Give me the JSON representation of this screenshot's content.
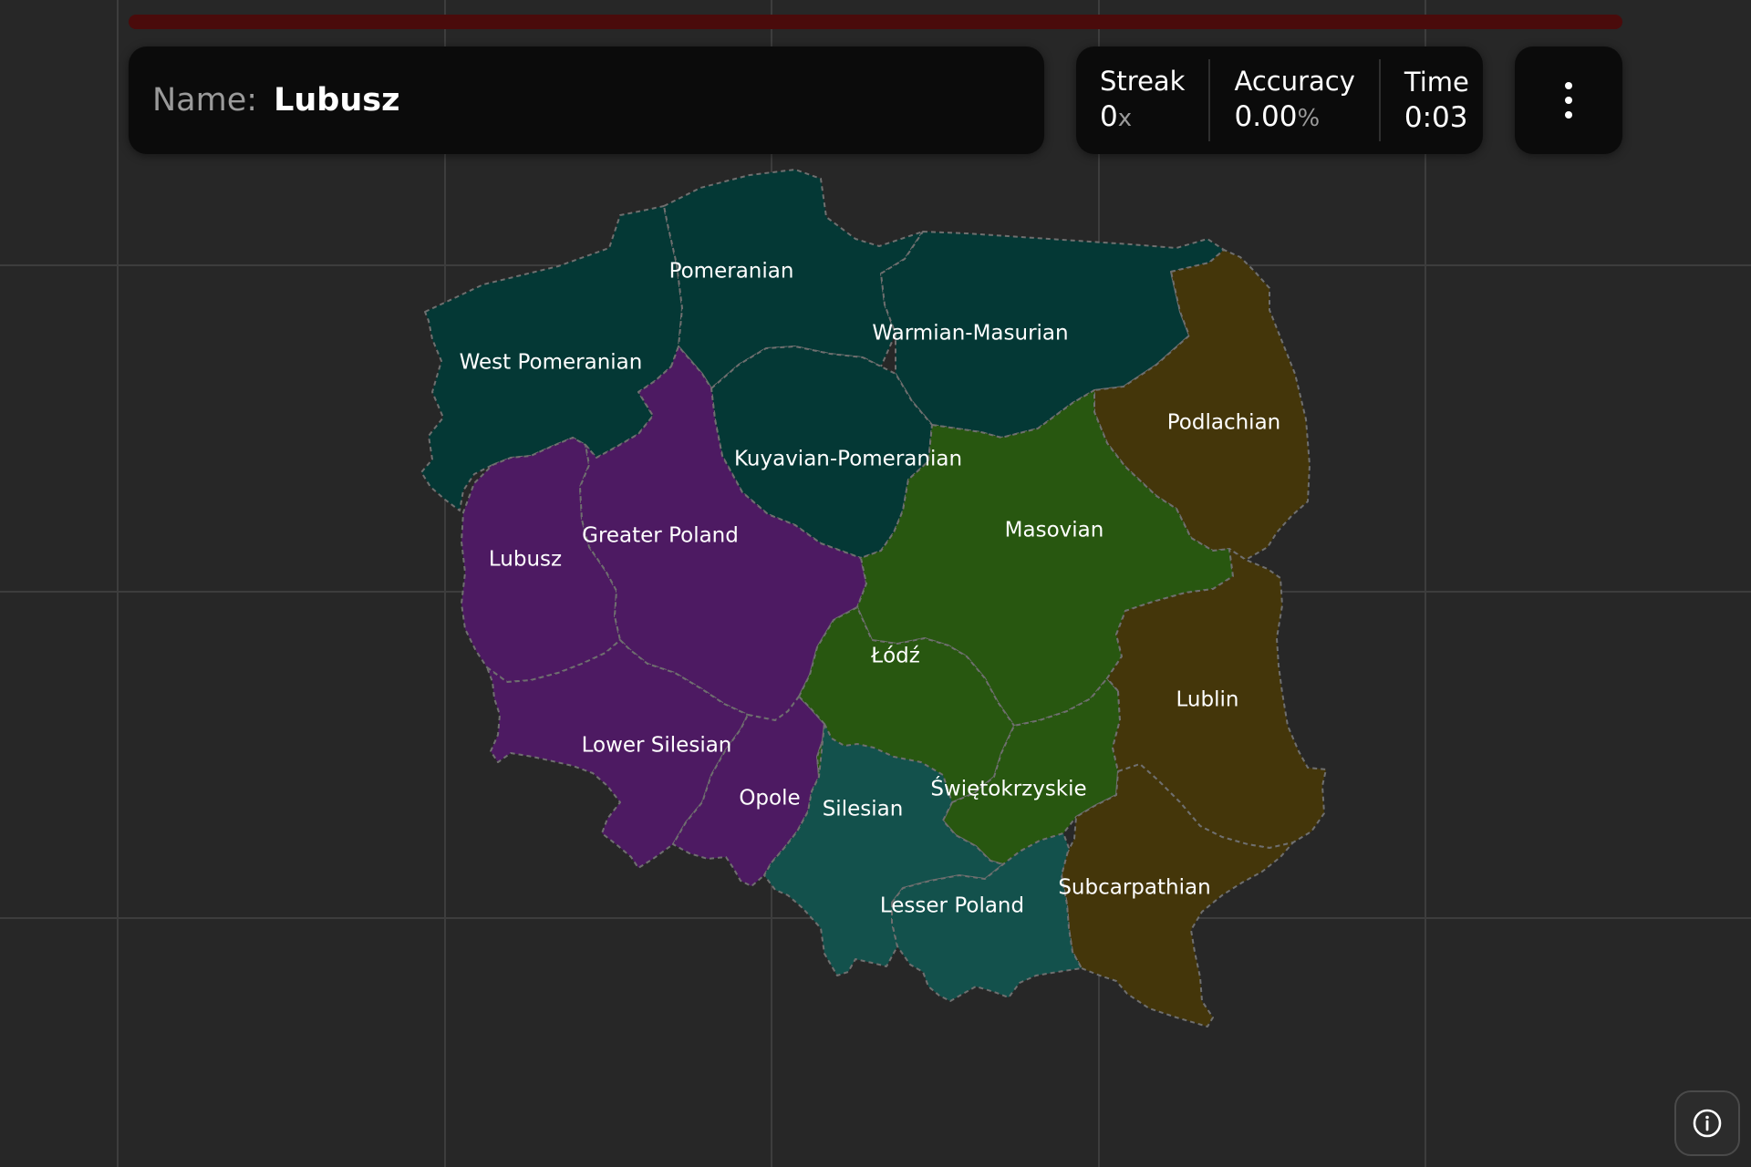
{
  "progress": {
    "fraction": 0,
    "track_color": "#4a0b0b",
    "fill_color": "#c0392b"
  },
  "prompt": {
    "prefix": "Name:",
    "value": "Lubusz"
  },
  "stats": {
    "streak": {
      "label": "Streak",
      "value": "0",
      "unit": "x"
    },
    "accuracy": {
      "label": "Accuracy",
      "value": "0.00",
      "unit": "%"
    },
    "time": {
      "label": "Time",
      "value": "0:03"
    }
  },
  "menu": {
    "icon": "more-vertical-icon"
  },
  "info": {
    "icon": "info-icon"
  },
  "map": {
    "country": "Poland",
    "regions": [
      {
        "id": "west-pomeranian",
        "name": "West Pomeranian",
        "color": "#043835"
      },
      {
        "id": "pomeranian",
        "name": "Pomeranian",
        "color": "#043835"
      },
      {
        "id": "warmian-masurian",
        "name": "Warmian-Masurian",
        "color": "#043835"
      },
      {
        "id": "kuyavian-pomeranian",
        "name": "Kuyavian-Pomeranian",
        "color": "#043835"
      },
      {
        "id": "podlachian",
        "name": "Podlachian",
        "color": "#44360a"
      },
      {
        "id": "lubusz",
        "name": "Lubusz",
        "color": "#4d1a62"
      },
      {
        "id": "greater-poland",
        "name": "Greater Poland",
        "color": "#4d1a62"
      },
      {
        "id": "lower-silesian",
        "name": "Lower Silesian",
        "color": "#4d1a62"
      },
      {
        "id": "opole",
        "name": "Opole",
        "color": "#4d1a62"
      },
      {
        "id": "masovian",
        "name": "Masovian",
        "color": "#285710"
      },
      {
        "id": "lodz",
        "name": "Łódź",
        "color": "#285710"
      },
      {
        "id": "swietokrzyskie",
        "name": "Świętokrzyskie",
        "color": "#285710"
      },
      {
        "id": "lublin",
        "name": "Lublin",
        "color": "#44360a"
      },
      {
        "id": "subcarpathian",
        "name": "Subcarpathian",
        "color": "#44360a"
      },
      {
        "id": "silesian",
        "name": "Silesian",
        "color": "#13514c"
      },
      {
        "id": "lesser-poland",
        "name": "Lesser Poland",
        "color": "#13514c"
      }
    ]
  }
}
